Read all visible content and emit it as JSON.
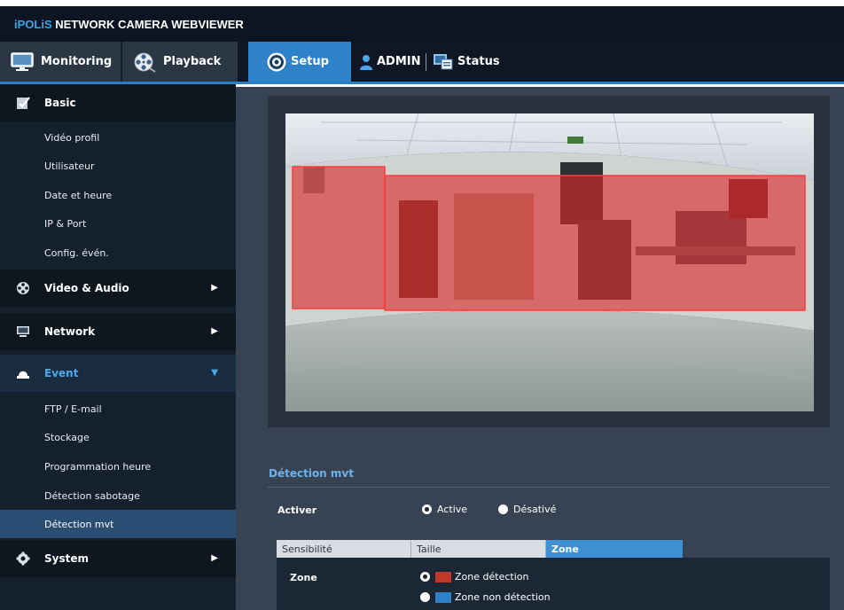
{
  "app": {
    "brand_prefix": "iPOLiS",
    "brand_suffix": "NETWORK CAMERA WEBVIEWER"
  },
  "nav": {
    "monitoring": "Monitoring",
    "playback": "Playback",
    "setup": "Setup",
    "admin": "ADMIN",
    "status": "Status"
  },
  "sidebar": {
    "basic": {
      "label": "Basic",
      "items": [
        "Vidéo profil",
        "Utilisateur",
        "Date et heure",
        "IP & Port",
        "Config. évén."
      ]
    },
    "video_audio": "Video & Audio",
    "network": "Network",
    "event": {
      "label": "Event",
      "items": [
        "FTP / E-mail",
        "Stockage",
        "Programmation heure",
        "Détection sabotage",
        "Détection mvt"
      ],
      "active_item": "Détection mvt"
    },
    "system": "System"
  },
  "content": {
    "section_title": "Détection mvt",
    "activer_label": "Activer",
    "activer_options": [
      "Active",
      "Désativé"
    ],
    "activer_selected": "Active",
    "subtabs": [
      "Sensibilité",
      "Taille",
      "Zone"
    ],
    "subtab_selected": "Zone",
    "zone_label": "Zone",
    "zone_options": [
      "Zone détection",
      "Zone non détection"
    ],
    "zone_selected": "Zone détection"
  },
  "colors": {
    "accent": "#2f82c8",
    "detection_zone": "#c0392b",
    "non_detection_zone": "#2f82c8",
    "section_title": "#6db3ea"
  }
}
